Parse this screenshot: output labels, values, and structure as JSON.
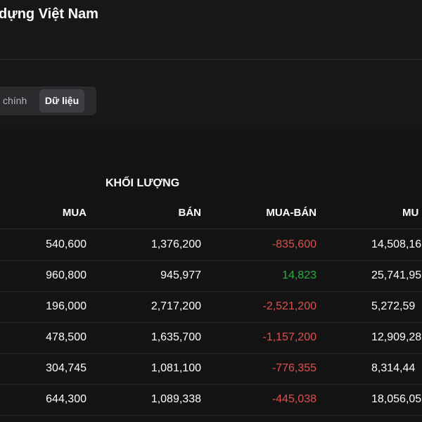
{
  "header": {
    "title": "dựng Việt Nam"
  },
  "tabs": [
    {
      "label": "chính",
      "active": false
    },
    {
      "label": "Dữ liệu",
      "active": true
    }
  ],
  "table": {
    "group_header": "KHỐI LƯỢNG",
    "columns": {
      "mua": "MUA",
      "ban": "BÁN",
      "mua_ban": "MUA-BÁN",
      "gia_tri": "MU"
    },
    "rows": [
      {
        "mua": "540,600",
        "ban": "1,376,200",
        "mua_ban": "-835,600",
        "gia_tri": "14,508,16"
      },
      {
        "mua": "960,800",
        "ban": "945,977",
        "mua_ban": "14,823",
        "gia_tri": "25,741,95"
      },
      {
        "mua": "196,000",
        "ban": "2,717,200",
        "mua_ban": "-2,521,200",
        "gia_tri": "5,272,59"
      },
      {
        "mua": "478,500",
        "ban": "1,635,700",
        "mua_ban": "-1,157,200",
        "gia_tri": "12,909,28"
      },
      {
        "mua": "304,745",
        "ban": "1,081,100",
        "mua_ban": "-776,355",
        "gia_tri": "8,314,44"
      },
      {
        "mua": "644,300",
        "ban": "1,089,338",
        "mua_ban": "-445,038",
        "gia_tri": "18,056,05"
      }
    ]
  },
  "colors": {
    "negative": "#e0504c",
    "positive": "#21b33d",
    "background": "#171719"
  }
}
